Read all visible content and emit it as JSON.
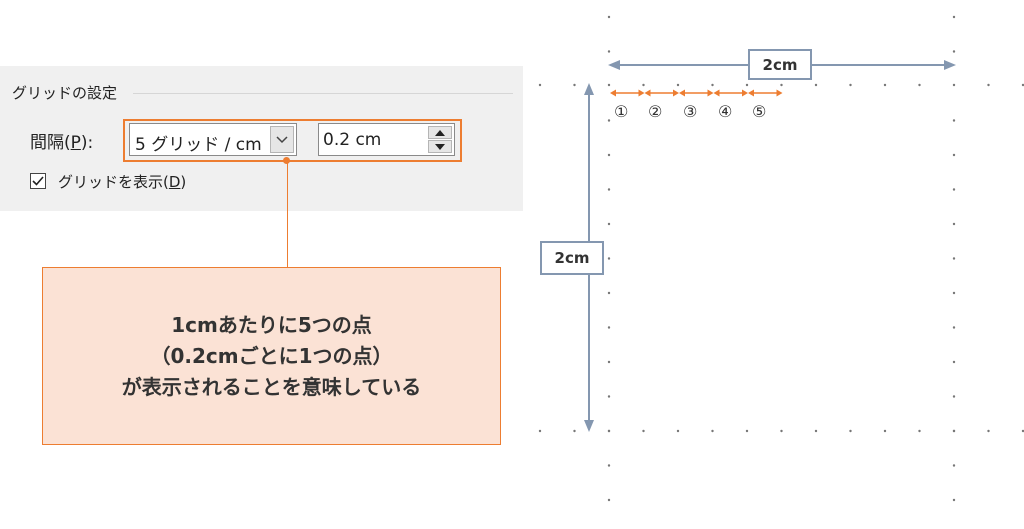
{
  "settings": {
    "section_title": "グリッドの設定",
    "spacing_label_prefix": "間隔(",
    "spacing_label_key": "P",
    "spacing_label_suffix": "):",
    "grid_option": "5 グリッド / cm",
    "spacing_value": "0.2 cm",
    "show_grid_label_prefix": "グリッドを表示(",
    "show_grid_label_key": "D",
    "show_grid_label_suffix": ")",
    "show_grid_checked": true
  },
  "callout": {
    "line1": "1cmあたりに5つの点",
    "line2": "（0.2cmごとに1つの点）",
    "line3": "が表示されることを意味している"
  },
  "diagram": {
    "width_label": "2cm",
    "height_label": "2cm",
    "intervals": [
      "①",
      "②",
      "③",
      "④",
      "⑤"
    ]
  },
  "colors": {
    "accent": "#ed7d31",
    "callout_fill": "#fbe2d5",
    "dimension": "#8497b0",
    "panel": "#f0f0f0"
  }
}
